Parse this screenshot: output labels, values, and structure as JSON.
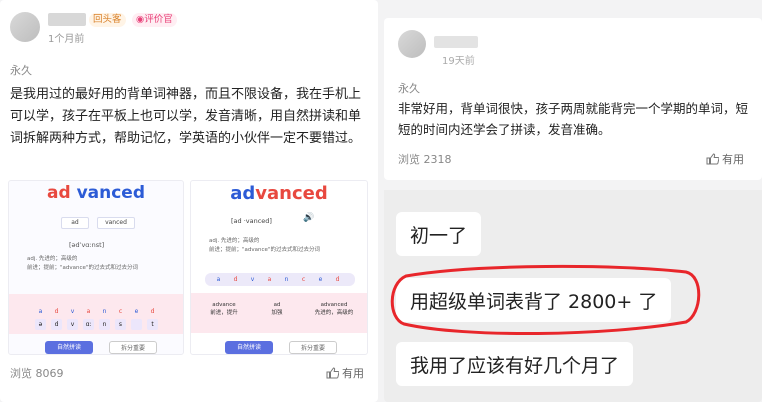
{
  "left_review": {
    "badge_returning": "回头客",
    "badge_reviewer": "评价官",
    "time": "1个月前",
    "spec": "永久",
    "text": "是我用过的最好用的背单词神器，而且不限设备，我在手机上可以学，孩子在平板上也可以学，发音清晰，用自然拼读和单词拆解两种方式，帮助记忆，学英语的小伙伴一定不要错过。",
    "views": "浏览 8069",
    "useful": "有用",
    "screenshot_a": {
      "word_part1": "ad",
      "word_part2": "vanced",
      "split1": "ad",
      "split2": "vanced",
      "phonetic": "[ədˈvɑːnst]",
      "pos": "adj.",
      "def1": "先进的；高级的",
      "def2": "前进；提前；\"advance\"的过去式和过去分词",
      "letters": [
        "a",
        "d",
        "v",
        "a",
        "n",
        "c",
        "e",
        "d"
      ],
      "phon_letters": [
        "ə",
        "d",
        "v",
        "ɑː",
        "n",
        "s",
        "",
        "t"
      ],
      "btn_primary": "自然拼读",
      "btn_secondary": "拆分重要"
    },
    "screenshot_b": {
      "word_part1": "ad",
      "word_part2": "vanced",
      "split_line": "[ad  ·vanced]",
      "pos": "adj.",
      "def1": "先进的；高级的",
      "def2": "前进；提前；\"advance\"的过去式和过去分词",
      "row_letters": [
        "a",
        "d",
        "v",
        "a",
        "n",
        "c",
        "e",
        "d"
      ],
      "block1_top": "advance",
      "block1_bottom": "前进，提升",
      "block2_top": "ad",
      "block2_bottom": "加强",
      "block3_top": "advanced",
      "block3_bottom": "先进的，高级的",
      "btn_primary": "自然拼读",
      "btn_secondary": "拆分重要"
    }
  },
  "right_review": {
    "time": "19天前",
    "spec": "永久",
    "text": "非常好用，背单词很快，孩子两周就能背完一个学期的单词，短短的时间内还学会了拼读，发音准确。",
    "views": "浏览 2318",
    "useful": "有用",
    "chat": {
      "msg1": "初一了",
      "msg2": "用超级单词表背了 2800+ 了",
      "msg3": "我用了应该有好几个月了"
    }
  },
  "colors": {
    "accent_orange": "#ff7a2f",
    "reviewer_pink": "#ff4d7a",
    "highlight_red": "#e8262b",
    "word_red": "#e8483f",
    "word_blue": "#2c5bd6"
  }
}
